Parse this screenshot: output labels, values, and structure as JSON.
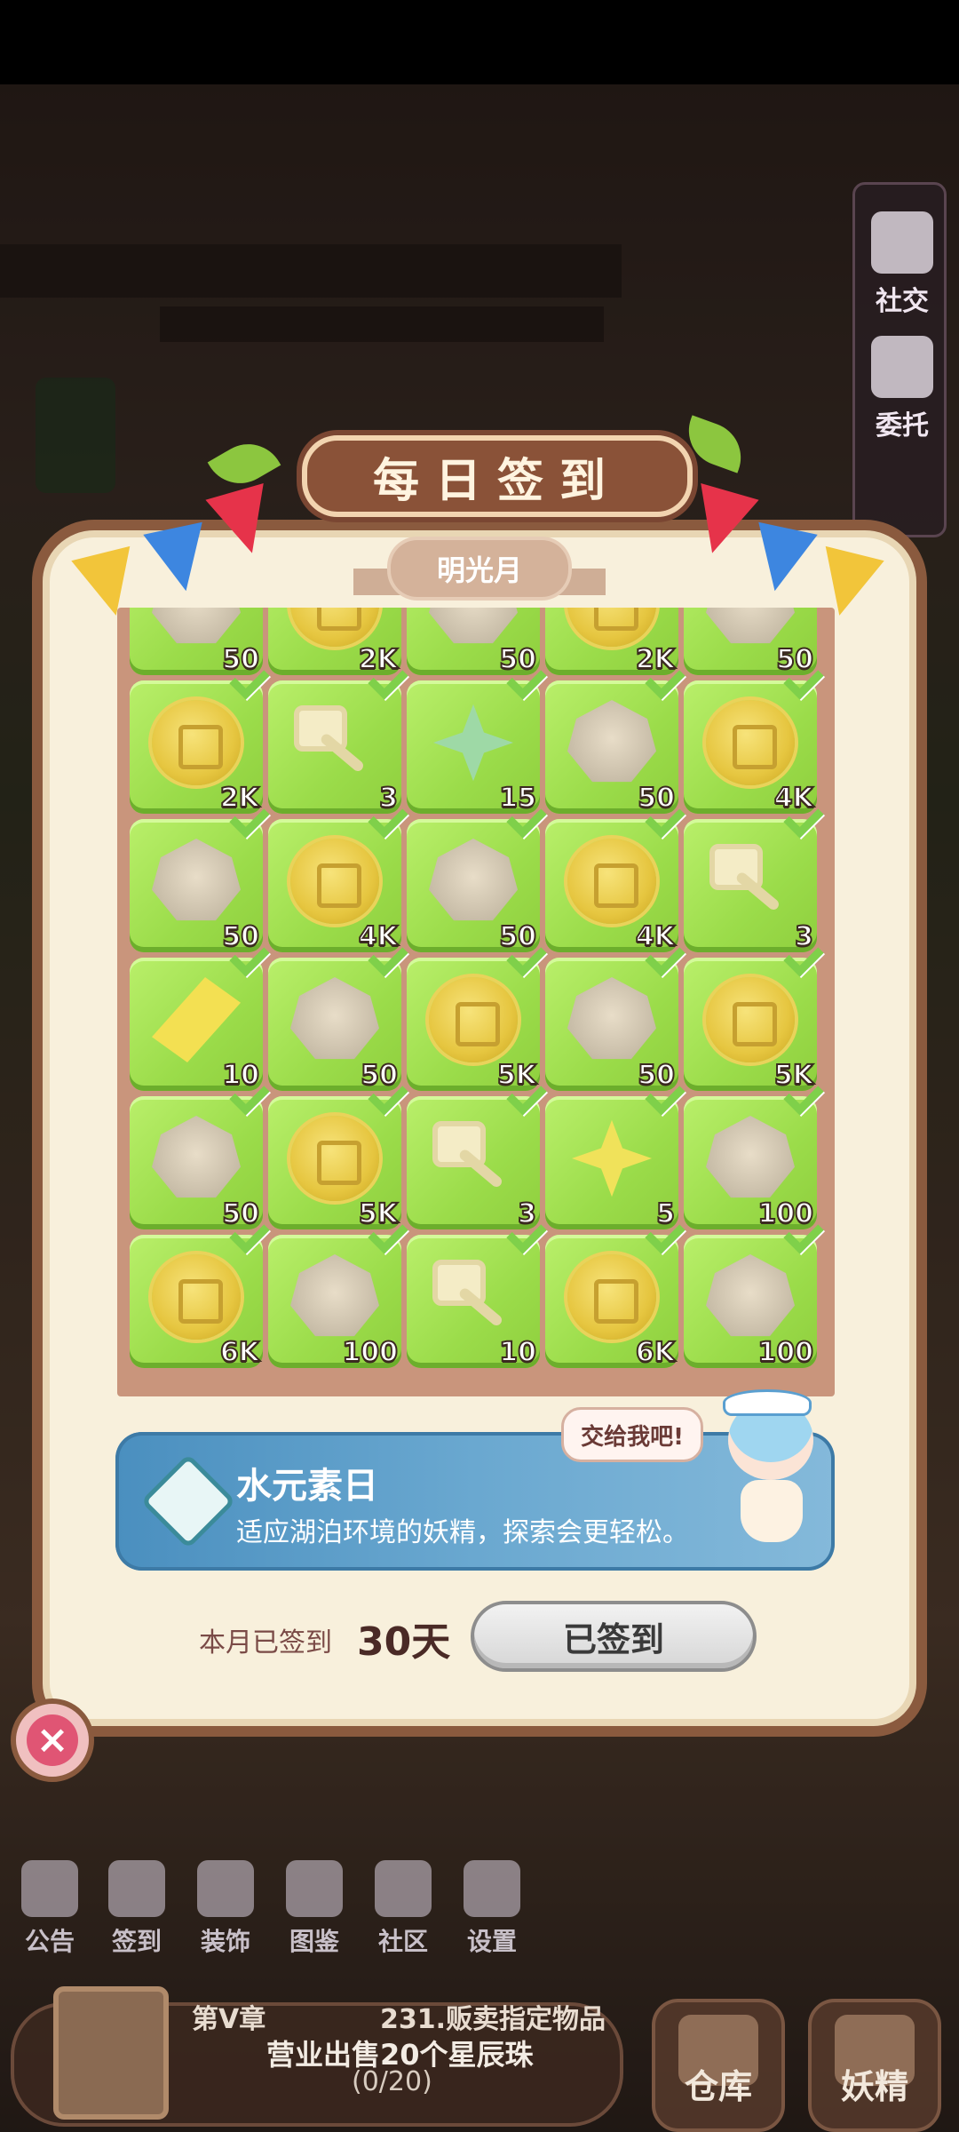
{
  "sidemenu": {
    "items": [
      {
        "label": "社交",
        "icon": "social-icon"
      },
      {
        "label": "委托",
        "icon": "commission-icon"
      }
    ]
  },
  "dialog": {
    "title": "每日签到",
    "month": "明光月"
  },
  "rewards": [
    {
      "item": "gem",
      "qty": "50"
    },
    {
      "item": "coin",
      "qty": "2K"
    },
    {
      "item": "gem",
      "qty": "50"
    },
    {
      "item": "coin",
      "qty": "2K"
    },
    {
      "item": "gem",
      "qty": "50"
    },
    {
      "item": "coin",
      "qty": "2K"
    },
    {
      "item": "key",
      "qty": "3"
    },
    {
      "item": "green-star",
      "qty": "15"
    },
    {
      "item": "gem",
      "qty": "50"
    },
    {
      "item": "coin",
      "qty": "4K"
    },
    {
      "item": "gem",
      "qty": "50"
    },
    {
      "item": "coin",
      "qty": "4K"
    },
    {
      "item": "gem",
      "qty": "50"
    },
    {
      "item": "coin",
      "qty": "4K"
    },
    {
      "item": "key",
      "qty": "3"
    },
    {
      "item": "yellow-crystal",
      "qty": "10"
    },
    {
      "item": "gem",
      "qty": "50"
    },
    {
      "item": "coin",
      "qty": "5K"
    },
    {
      "item": "gem",
      "qty": "50"
    },
    {
      "item": "coin",
      "qty": "5K"
    },
    {
      "item": "gem",
      "qty": "50"
    },
    {
      "item": "coin",
      "qty": "5K"
    },
    {
      "item": "key",
      "qty": "3"
    },
    {
      "item": "yellow-star",
      "qty": "5"
    },
    {
      "item": "gem",
      "qty": "100"
    },
    {
      "item": "coin",
      "qty": "6K"
    },
    {
      "item": "gem",
      "qty": "100"
    },
    {
      "item": "key",
      "qty": "10"
    },
    {
      "item": "coin",
      "qty": "6K"
    },
    {
      "item": "gem",
      "qty": "100"
    }
  ],
  "element_day": {
    "title": "水元素日",
    "description": "适应湖泊环境的妖精，探索会更轻松。",
    "speech": "交给我吧!"
  },
  "signin": {
    "label": "本月已签到",
    "days": "30天",
    "button_label": "已签到"
  },
  "toolbar": {
    "items": [
      {
        "label": "公告",
        "icon": "notice-icon"
      },
      {
        "label": "签到",
        "icon": "calendar-icon"
      },
      {
        "label": "装饰",
        "icon": "decoration-icon"
      },
      {
        "label": "图鉴",
        "icon": "book-icon"
      },
      {
        "label": "社区",
        "icon": "home-icon"
      },
      {
        "label": "设置",
        "icon": "gear-icon"
      }
    ]
  },
  "quest": {
    "chapter": "第V章",
    "task_title": "231.贩卖指定物品",
    "task_main": "营业出售20个星辰珠",
    "progress": "(0/20)"
  },
  "bottom_buttons": [
    {
      "label": "仓库",
      "icon": "warehouse-icon"
    },
    {
      "label": "妖精",
      "icon": "fairy-icon"
    }
  ],
  "colors": {
    "cell_green": "#9bdc4a",
    "panel_bg": "#f8f0dc",
    "frame_brown": "#8a5a3e",
    "banner_blue": "#6aa8d0",
    "close_red": "#e05574"
  }
}
